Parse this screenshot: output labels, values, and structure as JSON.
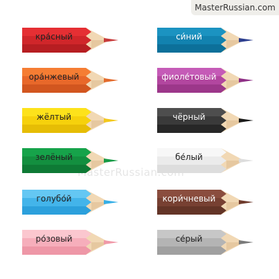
{
  "site": {
    "name": "MasterRussian.com"
  },
  "watermark": {
    "text": "MasterRussian.com"
  },
  "pencils": [
    {
      "label": "кра́сный",
      "colors": {
        "top": "#e52f33",
        "mid": "#d0262a",
        "bot": "#b71e22",
        "tip": "#c73a3a"
      },
      "text_color": "#222222"
    },
    {
      "label": "ора́нжевый",
      "colors": {
        "top": "#f57d33",
        "mid": "#e8682a",
        "bot": "#d2561f",
        "tip": "#e36a2c"
      },
      "text_color": "#222222"
    },
    {
      "label": "жёлтый",
      "colors": {
        "top": "#fde21b",
        "mid": "#f6d10c",
        "bot": "#e6bd05",
        "tip": "#f3c81a"
      },
      "text_color": "#222222"
    },
    {
      "label": "зелёный",
      "colors": {
        "top": "#16a34a",
        "mid": "#138f3f",
        "bot": "#0e7a35",
        "tip": "#169a45"
      },
      "text_color": "#222222"
    },
    {
      "label": "голубо́й",
      "colors": {
        "top": "#64c7f3",
        "mid": "#43b4ea",
        "bot": "#2ca0dc",
        "tip": "#35aee6"
      },
      "text_color": "#222222"
    },
    {
      "label": "ро́зовый",
      "colors": {
        "top": "#fbc7cf",
        "mid": "#f6aebb",
        "bot": "#ee97a7",
        "tip": "#f099a8"
      },
      "text_color": "#222222"
    },
    {
      "label": "си́ний",
      "colors": {
        "top": "#1b93c1",
        "mid": "#1282af",
        "bot": "#0c709a",
        "tip": "#2c3e8f"
      },
      "text_color": "#ffffff"
    },
    {
      "label": "фиоле́товый",
      "colors": {
        "top": "#c55bb7",
        "mid": "#b2469f",
        "bot": "#9c378a",
        "tip": "#8e2f86"
      },
      "text_color": "#ffffff"
    },
    {
      "label": "чёрный",
      "colors": {
        "top": "#4e4e4e",
        "mid": "#3a3a3a",
        "bot": "#272727",
        "tip": "#1a1a1a"
      },
      "text_color": "#ffffff"
    },
    {
      "label": "бе́лый",
      "colors": {
        "top": "#f7f7f7",
        "mid": "#ebebeb",
        "bot": "#dddddd",
        "tip": "#dddddd"
      },
      "text_color": "#222222"
    },
    {
      "label": "кори́чневый",
      "colors": {
        "top": "#8a4d3e",
        "mid": "#774032",
        "bot": "#633427",
        "tip": "#6e3a2c"
      },
      "text_color": "#ffffff"
    },
    {
      "label": "се́рый",
      "colors": {
        "top": "#c7c7c7",
        "mid": "#b4b4b4",
        "bot": "#a0a0a0",
        "tip": "#7a7a7a"
      },
      "text_color": "#222222"
    }
  ]
}
